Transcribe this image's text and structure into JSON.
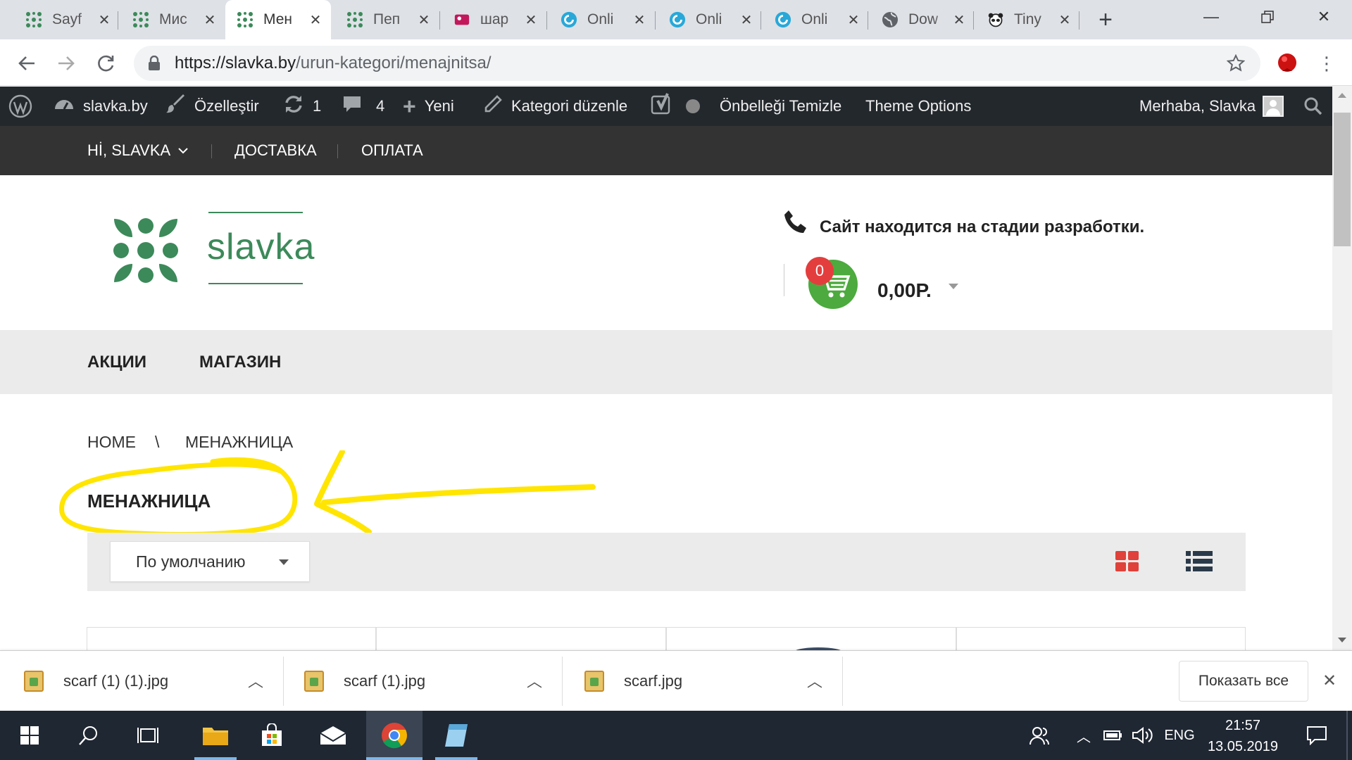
{
  "browser": {
    "tabs": [
      {
        "title": "Sayf",
        "favicon": "slavka-flower-icon"
      },
      {
        "title": "Мис",
        "favicon": "slavka-flower-icon"
      },
      {
        "title": "Мен",
        "favicon": "slavka-flower-icon",
        "active": true
      },
      {
        "title": "Пеп",
        "favicon": "slavka-flower-icon"
      },
      {
        "title": "шар",
        "favicon": "image-site-icon"
      },
      {
        "title": "Onli",
        "favicon": "spiral-icon"
      },
      {
        "title": "Onli",
        "favicon": "spiral-icon"
      },
      {
        "title": "Onli",
        "favicon": "spiral-icon"
      },
      {
        "title": "Dow",
        "favicon": "globe-icon"
      },
      {
        "title": "Tiny",
        "favicon": "panda-icon"
      }
    ],
    "url_domain": "https://slavka.by",
    "url_path": "/urun-kategori/menajnitsa/"
  },
  "adminbar": {
    "site": "slavka.by",
    "customize": "Özelleştir",
    "updates": "1",
    "comments": "4",
    "new": "Yeni",
    "edit_category": "Kategori düzenle",
    "clear_cache": "Önbelleği Temizle",
    "theme_options": "Theme Options",
    "greeting": "Merhaba, Slavka"
  },
  "topmenu": {
    "hi": "Hİ, SLAVKA",
    "delivery": "ДОСТАВКА",
    "payment": "ОПЛАТА"
  },
  "header": {
    "logo_text": "slavka",
    "notice": "Сайт находится на стадии разработки.",
    "cart_count": "0",
    "cart_total": "0,00Р."
  },
  "mainnav": {
    "sales": "АКЦИИ",
    "shop": "МАГАЗИН"
  },
  "breadcrumb": {
    "home": "HOME",
    "sep": "\\",
    "current": "МЕНАЖНИЦА"
  },
  "page_title": "МЕНАЖНИЦА",
  "sort": {
    "selected": "По умолчанию"
  },
  "downloads": {
    "files": [
      "scarf (1) (1).jpg",
      "scarf (1).jpg",
      "scarf.jpg"
    ],
    "show_all": "Показать все"
  },
  "taskbar": {
    "language": "ENG",
    "time": "21:57",
    "date": "13.05.2019"
  },
  "colors": {
    "brand_green": "#3c8a5a",
    "annotation_yellow": "#ffe500",
    "grid_red": "#e0413a",
    "adminbar": "#23282d"
  }
}
